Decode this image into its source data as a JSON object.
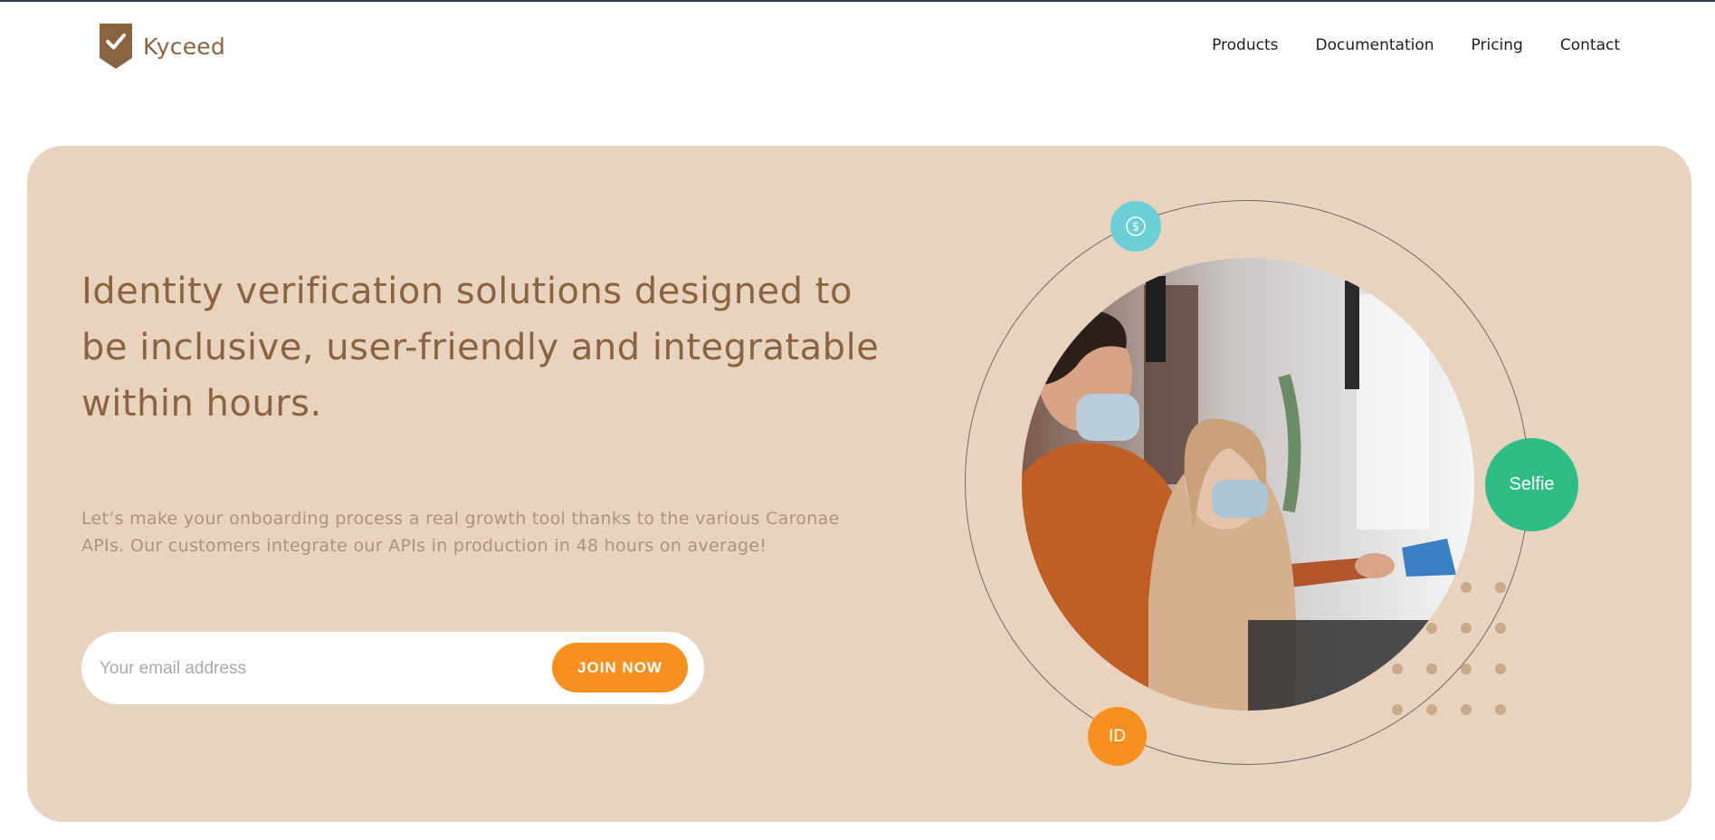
{
  "brand": {
    "name": "Kyceed",
    "logo_icon": "shield-check-icon",
    "color": "#8a6440"
  },
  "nav": {
    "items": [
      "Products",
      "Documentation",
      "Pricing",
      "Contact"
    ]
  },
  "hero": {
    "background": "#e8d3bf",
    "headline": "Identity verification solutions designed to be inclusive, user-friendly and integratable within hours.",
    "subtext": "Let’s make your onboarding process a real growth tool thanks to the various Caronae APIs. Our customers integrate our APIs in production in 48 hours on average!",
    "signup": {
      "placeholder": "Your email address",
      "value": "",
      "button_label": "JOIN NOW",
      "button_color": "#f7901e"
    },
    "visual": {
      "photo_description_icon": "people-paying-at-counter-photo",
      "bubbles": {
        "money": {
          "icon": "dollar-coin-icon",
          "color": "#6ccfd6"
        },
        "selfie": {
          "label": "Selfie",
          "color": "#2dbd85"
        },
        "id": {
          "label": "ID",
          "color": "#f7901e"
        }
      }
    }
  }
}
